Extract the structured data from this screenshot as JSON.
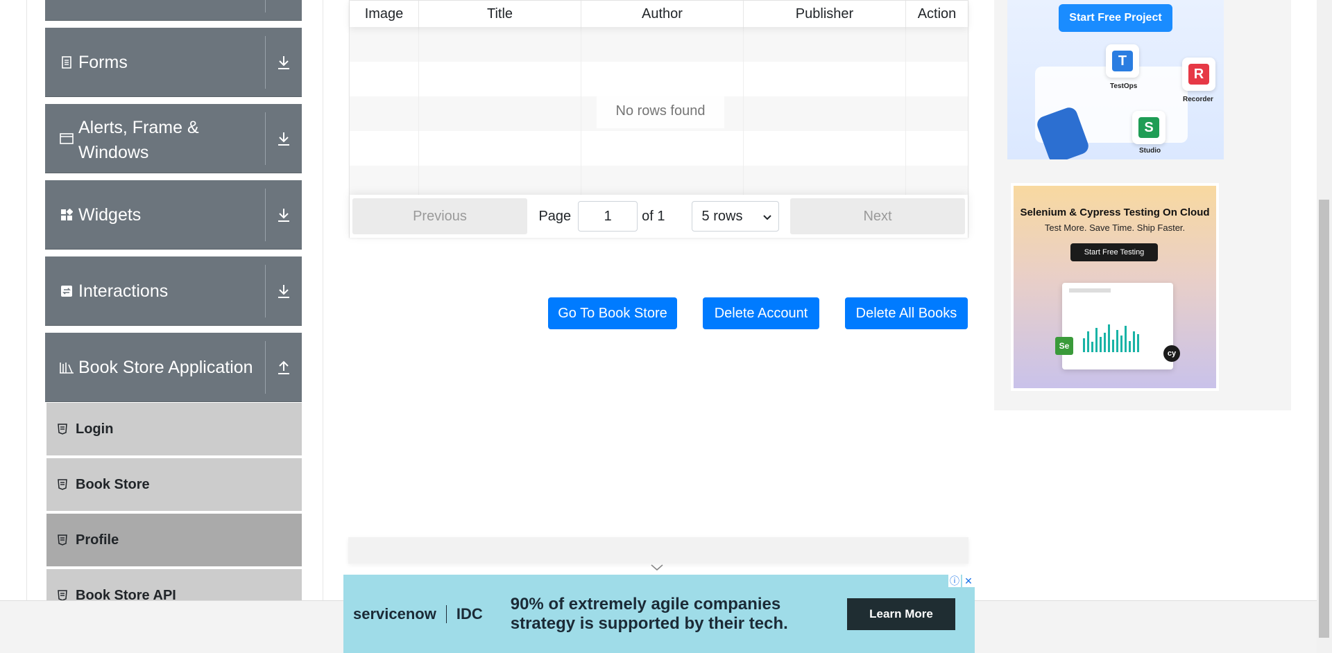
{
  "sidebar": {
    "groups": [
      {
        "label": "",
        "icon": "partial-group"
      },
      {
        "label": "Forms",
        "icon": "document-icon"
      },
      {
        "label": "Alerts, Frame & Windows",
        "icon": "window-icon"
      },
      {
        "label": "Widgets",
        "icon": "widgets-icon"
      },
      {
        "label": "Interactions",
        "icon": "interactions-icon"
      },
      {
        "label": "Book Store Application",
        "icon": "books-icon"
      }
    ],
    "items": [
      {
        "label": "Login"
      },
      {
        "label": "Book Store"
      },
      {
        "label": "Profile",
        "active": true
      },
      {
        "label": "Book Store API"
      }
    ]
  },
  "table": {
    "columns": [
      "Image",
      "Title",
      "Author",
      "Publisher",
      "Action"
    ],
    "empty_text": "No rows found",
    "pagination": {
      "previous": "Previous",
      "page_label": "Page",
      "page_value": "1",
      "of_label": "of 1",
      "rows_option": "5 rows",
      "next": "Next"
    }
  },
  "actions": {
    "go_to_store": "Go To Book Store",
    "delete_account": "Delete Account",
    "delete_all_books": "Delete All Books"
  },
  "ads": {
    "top": {
      "button": "Start Free Project",
      "tiles": [
        "TestOps",
        "Recorder",
        "Studio"
      ]
    },
    "middle": {
      "title": "Selenium & Cypress Testing On Cloud",
      "subtitle": "Test More. Save Time. Ship Faster.",
      "button": "Start Free Testing"
    },
    "bottom": {
      "brand": "servicenow",
      "brand2": "IDC",
      "text": "90% of extremely agile companies strategy is supported by their tech.",
      "button": "Learn More"
    }
  },
  "colors": {
    "sidebar_group": "#6c757d",
    "sub_item": "#cccccc",
    "sub_item_active": "#aaaaaa",
    "primary": "#007bff",
    "ad_bottom": "#9fdce8"
  }
}
